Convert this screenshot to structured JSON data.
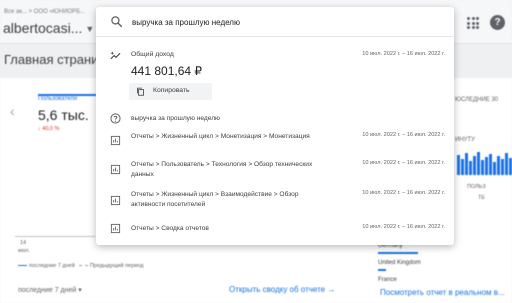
{
  "header": {
    "breadcrumb": "Все ак...  >  ООО «ЮНИОРБ...",
    "account": "albertocasi..."
  },
  "page": {
    "title": "Главная страни..."
  },
  "dashboard": {
    "metric_label": "Пользователи",
    "metric_value": "5,6 тыс.",
    "metric_change": "↓ 40,0 %",
    "x_tick_day": "14",
    "x_tick_month": "июл.",
    "legend_current": "последние 7 дней",
    "legend_previous": "Предыдущий период",
    "range_select": "последние 7 дней",
    "report_link": "Открыть сводку об отчете →"
  },
  "realtime": {
    "title": "ЮСЛЕДНИЕ 30",
    "subtitle": "ИНУТУ",
    "caption1": "ПОЛЬЗ",
    "caption2": "ТЕ",
    "countries": [
      "Germany",
      "United Kingdom",
      "France"
    ],
    "link": "Посмотреть отчет в реальном в..."
  },
  "search": {
    "query": "выручка за прошлую неделю",
    "icon": "search-icon"
  },
  "results": {
    "revenue": {
      "title": "Общий доход",
      "value": "441 801,64 ₽",
      "date": "10 июл. 2022 г. – 16 июл. 2022 г.",
      "copy_label": "Копировать",
      "icon": "insights-sparkle-icon"
    },
    "suggestion": {
      "text": "выручка за прошлую неделю",
      "icon": "help-question-icon"
    },
    "reports": [
      {
        "text": "Отчеты > Жизненный цикл > Монетизация > Монетизация",
        "date": "10 июл. 2022 г. – 16 июл. 2022 г."
      },
      {
        "text": "Отчеты > Пользователь > Технология > Обзор технических данных",
        "date": "10 июл. 2022 г. – 16 июл. 2022 г."
      },
      {
        "text": "Отчеты > Жизненный цикл > Взаимодействие > Обзор активности посетителей",
        "date": "10 июл. 2022 г. – 16 июл. 2022 г."
      },
      {
        "text": "Отчеты > Сводка отчетов",
        "date": "10 июл. 2022 г. – 16 июл. 2022 г."
      }
    ]
  },
  "colors": {
    "accent": "#1a73e8",
    "negative": "#d93025",
    "text": "#202124"
  }
}
